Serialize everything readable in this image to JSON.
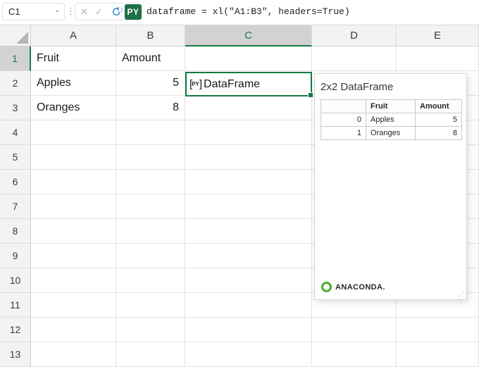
{
  "formula_bar": {
    "name_box": "C1",
    "cancel_icon": "✕",
    "enter_icon": "✓",
    "language_badge": "PY",
    "formula": "dataframe = xl(\"A1:B3\", headers=True)"
  },
  "colors": {
    "excel_green": "#107c41",
    "py_badge_green": "#1e7145",
    "anaconda_green": "#43b02a",
    "selected_header_bg": "#d2d2d2",
    "python_icon_blue": "#2e86d1"
  },
  "spreadsheet": {
    "columns": [
      "A",
      "B",
      "C",
      "D",
      "E"
    ],
    "rows": [
      "1",
      "2",
      "3",
      "4",
      "5",
      "6",
      "7",
      "8",
      "9",
      "10",
      "11",
      "12",
      "13"
    ],
    "selected_column": "C",
    "selected_row": "1",
    "cells": {
      "A1": "Fruit",
      "B1": "Amount",
      "A2": "Apples",
      "B2": "5",
      "A3": "Oranges",
      "B3": "8"
    },
    "right_aligned": [
      "B2",
      "B3"
    ],
    "selected_cell": {
      "ref": "C1",
      "icon_text": "PY",
      "label": "DataFrame"
    }
  },
  "dataframe_preview": {
    "title": "2x2 DataFrame",
    "table": {
      "headers": [
        "",
        "Fruit",
        "Amount"
      ],
      "rows": [
        [
          "0",
          "Apples",
          "5"
        ],
        [
          "1",
          "Oranges",
          "8"
        ]
      ]
    },
    "branding": "ANACONDA."
  }
}
